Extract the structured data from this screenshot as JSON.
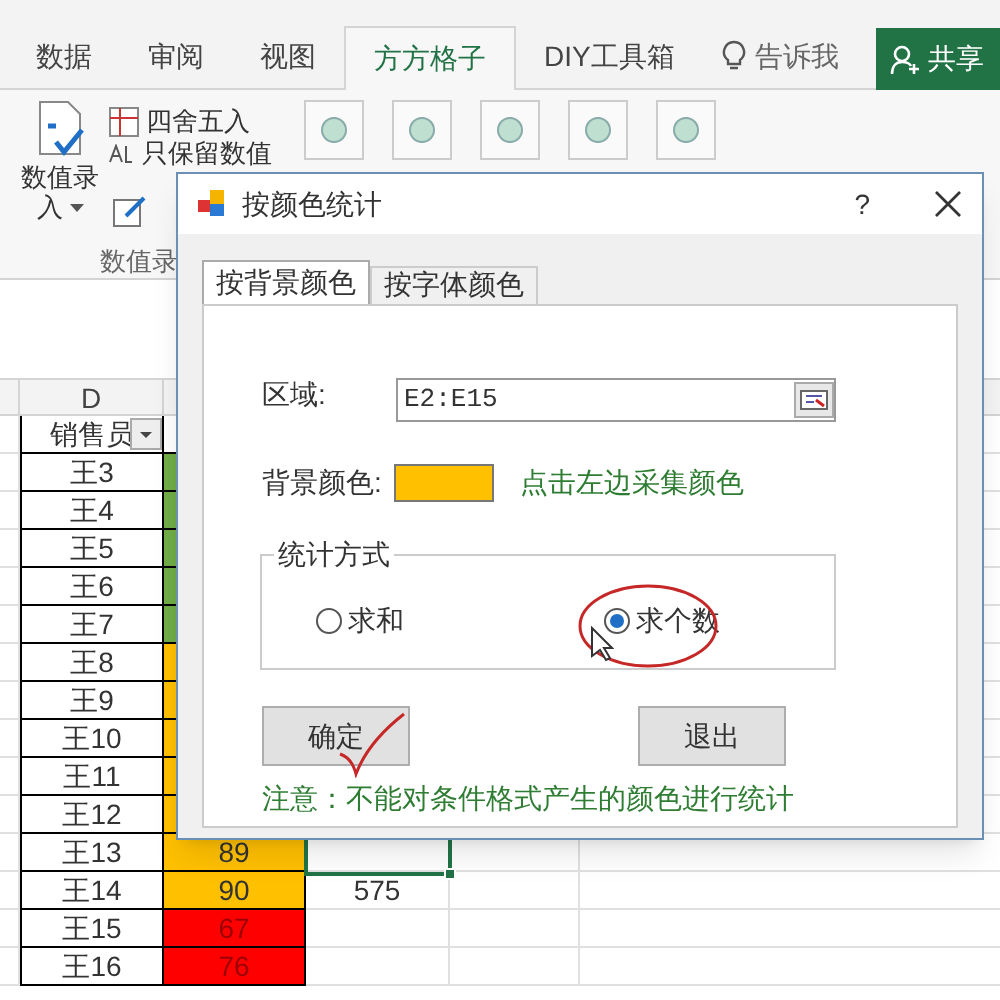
{
  "ribbon_tabs": [
    {
      "label": "数据",
      "selected": false
    },
    {
      "label": "审阅",
      "selected": false
    },
    {
      "label": "视图",
      "selected": false
    },
    {
      "label": "方方格子",
      "selected": true
    },
    {
      "label": "DIY工具箱",
      "selected": false
    }
  ],
  "tell_me": "告诉我",
  "share_button": "共享",
  "ribbon": {
    "big_button": [
      "数值录",
      "入"
    ],
    "small_buttons": [
      "四舍五入",
      "只保留数值"
    ],
    "group_label": "数值录"
  },
  "sheet": {
    "column_header": "D",
    "header_cell": "销售员",
    "rows": [
      {
        "name": "王3",
        "color": "#70ad47"
      },
      {
        "name": "王4",
        "color": "#70ad47"
      },
      {
        "name": "王5",
        "color": "#70ad47"
      },
      {
        "name": "王6",
        "color": "#70ad47"
      },
      {
        "name": "王7",
        "color": "#70ad47"
      },
      {
        "name": "王8",
        "color": "#ffc000"
      },
      {
        "name": "王9",
        "color": "#ffc000"
      },
      {
        "name": "王10",
        "color": "#ffc000"
      },
      {
        "name": "王11",
        "color": "#ffc000"
      },
      {
        "name": "王12",
        "color": "#ffc000"
      },
      {
        "name": "王13",
        "color": "#ffc000",
        "value": "89"
      },
      {
        "name": "王14",
        "color": "#ffc000",
        "value": "90",
        "result": "575"
      },
      {
        "name": "王15",
        "color": "#ff0000",
        "value": "67"
      },
      {
        "name": "王16",
        "color": "#ff0000",
        "value": "76"
      }
    ]
  },
  "dialog": {
    "title": "按颜色统计",
    "help": "?",
    "tabs": [
      {
        "label": "按背景颜色",
        "selected": true
      },
      {
        "label": "按字体颜色",
        "selected": false
      }
    ],
    "range_label": "区域:",
    "range_value": "E2:E15",
    "color_label": "背景颜色:",
    "color": "#ffc000",
    "pick_hint": "点击左边采集颜色",
    "method": {
      "title": "统计方式",
      "options": [
        {
          "label": "求和",
          "selected": false
        },
        {
          "label": "求个数",
          "selected": true
        }
      ]
    },
    "buttons": [
      "确定",
      "退出"
    ],
    "note": "注意：不能对条件格式产生的颜色进行统计"
  }
}
